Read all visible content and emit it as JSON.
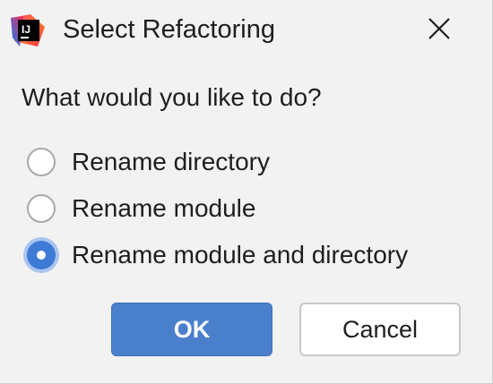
{
  "window": {
    "title": "Select Refactoring",
    "app_icon": "intellij-idea-icon",
    "close_icon": "close-icon"
  },
  "prompt": {
    "question": "What would you like to do?"
  },
  "options": [
    {
      "label": "Rename directory",
      "selected": false
    },
    {
      "label": "Rename module",
      "selected": false
    },
    {
      "label": "Rename module and directory",
      "selected": true
    }
  ],
  "buttons": {
    "ok_label": "OK",
    "cancel_label": "Cancel"
  },
  "colors": {
    "accent": "#4a7fcb",
    "radio_selected": "#3e7bd6",
    "background": "#f2f2f2"
  }
}
